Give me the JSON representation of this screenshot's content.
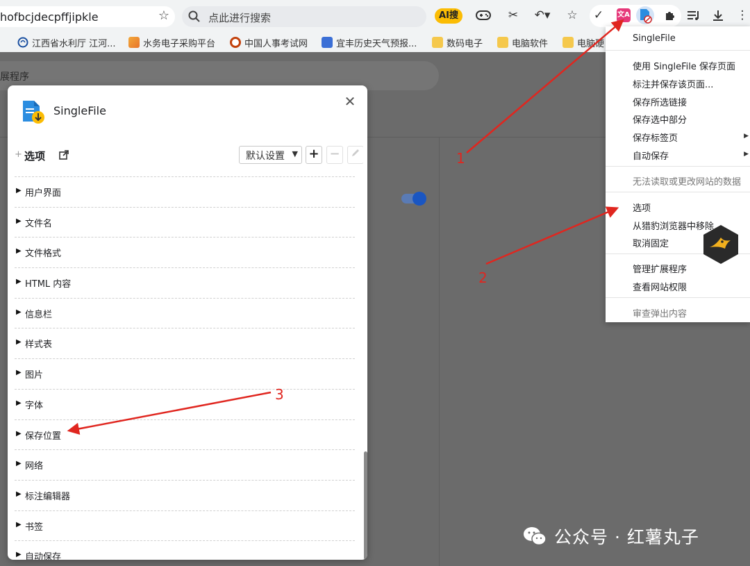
{
  "toolbar": {
    "address": "hofbcjdecpffjipkle",
    "search_placeholder": "点此进行搜索",
    "ai_label": "AI搜",
    "icons": [
      "game-icon",
      "scissors-icon",
      "undo-icon",
      "star-icon",
      "check-icon",
      "translate-icon",
      "singlefile-extension-icon",
      "puzzle-icon",
      "playlist-icon",
      "download-icon",
      "more-icon"
    ],
    "translate_label": "文A"
  },
  "bookmarks": [
    {
      "label": "江西省水利厅 江河...",
      "color": "#1a4fa0"
    },
    {
      "label": "水务电子采购平台",
      "color": "#e8732a"
    },
    {
      "label": "中国人事考试网",
      "color": "#c2410c"
    },
    {
      "label": "宜丰历史天气预报...",
      "color": "#3b6fd6"
    },
    {
      "label": "数码电子",
      "color": "#f5c84c"
    },
    {
      "label": "电脑软件",
      "color": "#f5c84c"
    },
    {
      "label": "电脑硬",
      "color": "#f5c84c"
    }
  ],
  "page": {
    "search_text": "展程序",
    "toggle_on": true
  },
  "dialog": {
    "title": "SingleFile",
    "options_plus": "+",
    "options_title": "选项",
    "profile_selected": "默认设置",
    "sections": [
      "用户界面",
      "文件名",
      "文件格式",
      "HTML 内容",
      "信息栏",
      "样式表",
      "图片",
      "字体",
      "保存位置",
      "网络",
      "标注编辑器",
      "书签",
      "自动保存"
    ]
  },
  "menu": {
    "header": "SingleFile",
    "items": [
      {
        "label": "使用 SingleFile 保存页面",
        "disabled": false,
        "submenu": false
      },
      {
        "label": "标注并保存该页面...",
        "disabled": false,
        "submenu": false
      },
      {
        "label": "保存所选链接",
        "disabled": false,
        "submenu": false
      },
      {
        "label": "保存选中部分",
        "disabled": false,
        "submenu": false
      },
      {
        "label": "保存标签页",
        "disabled": false,
        "submenu": true
      },
      {
        "label": "自动保存",
        "disabled": false,
        "submenu": true
      },
      {
        "label": "无法读取或更改网站的数据",
        "disabled": true,
        "submenu": false
      },
      {
        "label": "选项",
        "disabled": false,
        "submenu": false
      },
      {
        "label": "从猎豹浏览器中移除",
        "disabled": false,
        "submenu": false
      },
      {
        "label": "取消固定",
        "disabled": false,
        "submenu": false
      },
      {
        "label": "管理扩展程序",
        "disabled": false,
        "submenu": false
      },
      {
        "label": "查看网站权限",
        "disabled": false,
        "submenu": false
      },
      {
        "label": "审查弹出内容",
        "disabled": false,
        "submenu": false
      }
    ]
  },
  "annotations": {
    "marks": [
      "1",
      "2",
      "3"
    ],
    "color": "#e0261f"
  },
  "watermark": {
    "text": "公众号 · 红薯丸子"
  }
}
